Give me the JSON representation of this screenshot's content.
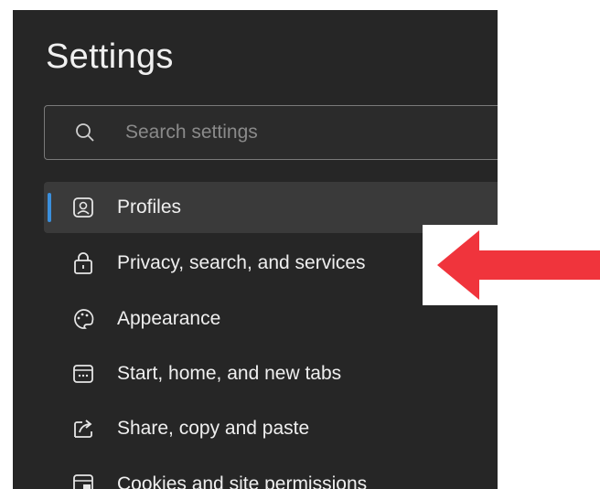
{
  "settings": {
    "title": "Settings",
    "search": {
      "placeholder": "Search settings",
      "icon": "search-icon"
    },
    "nav": [
      {
        "label": "Profiles",
        "icon": "profile-icon",
        "active": true
      },
      {
        "label": "Privacy, search, and services",
        "icon": "lock-icon",
        "active": false
      },
      {
        "label": "Appearance",
        "icon": "palette-icon",
        "active": false
      },
      {
        "label": "Start, home, and new tabs",
        "icon": "home-tabs-icon",
        "active": false
      },
      {
        "label": "Share, copy and paste",
        "icon": "share-icon",
        "active": false
      },
      {
        "label": "Cookies and site permissions",
        "icon": "cookies-icon",
        "active": false
      }
    ]
  },
  "annotation": {
    "arrow_color": "#f0343c",
    "target": "Privacy, search, and services"
  },
  "colors": {
    "panel_bg": "#262626",
    "active_bg": "#3a3a3a",
    "accent": "#3b8fdc"
  }
}
